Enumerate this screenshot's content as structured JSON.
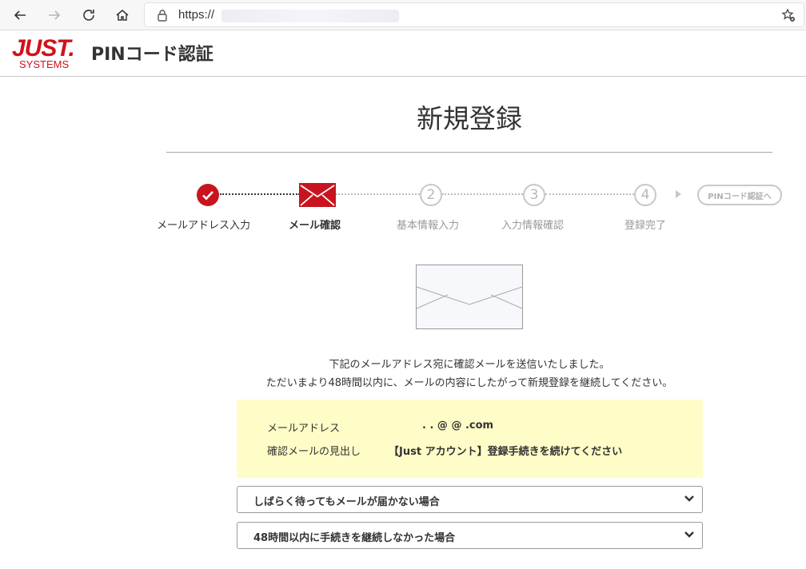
{
  "browser": {
    "url_prefix": "https://",
    "icons": [
      "back-icon",
      "forward-icon",
      "reload-icon",
      "home-icon",
      "lock-icon",
      "favorite-icon"
    ]
  },
  "header": {
    "logo_main": "JUST.",
    "logo_sub": "SYSTEMS",
    "title": "PINコード認証"
  },
  "page": {
    "title": "新規登録"
  },
  "stepper": {
    "steps": [
      {
        "label": "メールアドレス入力",
        "status": "done"
      },
      {
        "label": "メール確認",
        "status": "current"
      },
      {
        "label": "基本情報入力",
        "number": "2",
        "status": "todo"
      },
      {
        "label": "入力情報確認",
        "number": "3",
        "status": "todo"
      },
      {
        "label": "登録完了",
        "number": "4",
        "status": "todo"
      }
    ],
    "final_button": "PINコード認証へ"
  },
  "message": {
    "line1": "下記のメールアドレス宛に確認メールを送信いたしました。",
    "line2": "ただいまより48時間以内に、メールの内容にしたがって新規登録を継続してください。"
  },
  "info": {
    "email_label": "メールアドレス",
    "email_value": ".   .      @  @         .com",
    "subject_label": "確認メールの見出し",
    "subject_value": "【Just アカウント】登録手続きを続けてください"
  },
  "accordions": [
    {
      "label": "しばらく待ってもメールが届かない場合"
    },
    {
      "label": "48時間以内に手続きを継続しなかった場合"
    }
  ],
  "colors": {
    "brand_red": "#c8141e",
    "info_bg": "#fffdc7",
    "inactive": "#c8c8c8"
  }
}
